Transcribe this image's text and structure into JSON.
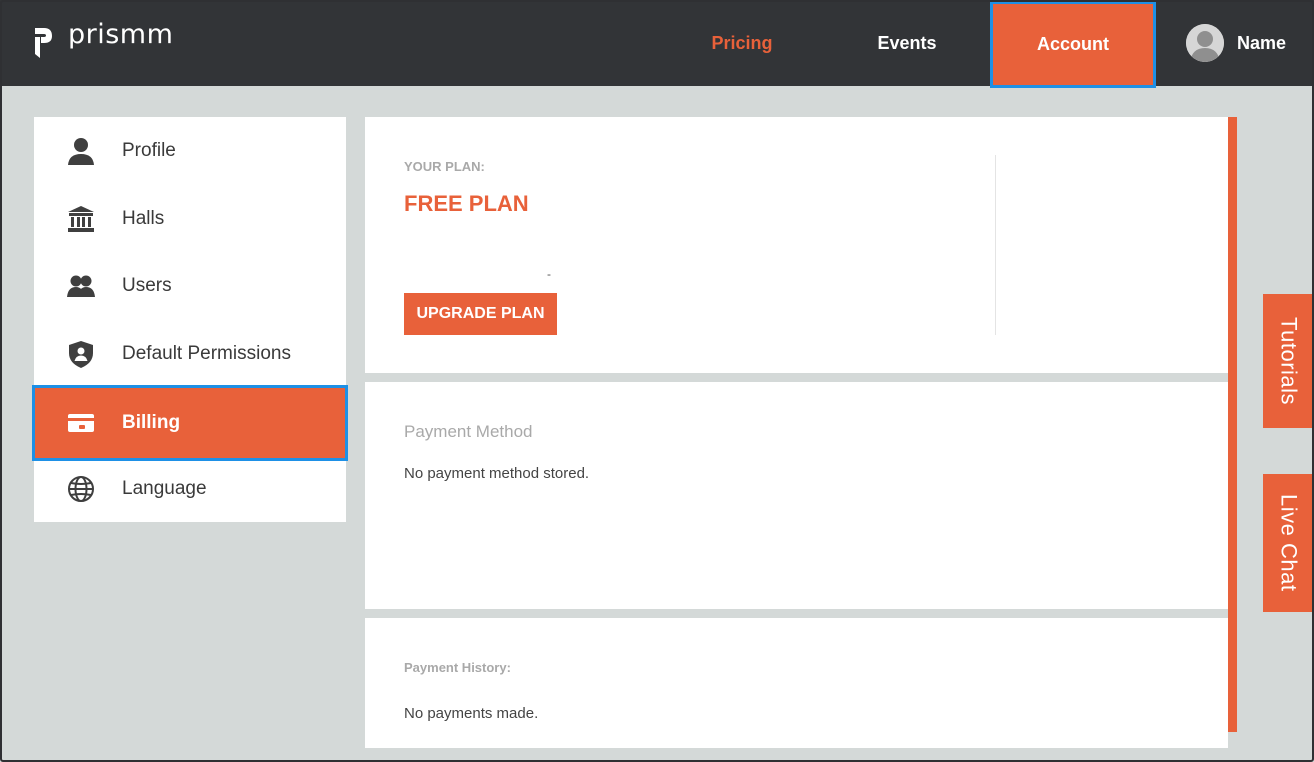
{
  "app": {
    "logo_text": "prismm"
  },
  "nav": {
    "pricing": "Pricing",
    "events": "Events",
    "account": "Account",
    "user_name": "Name"
  },
  "sidebar": {
    "items": [
      {
        "label": "Profile",
        "icon": "person-icon"
      },
      {
        "label": "Halls",
        "icon": "building-icon"
      },
      {
        "label": "Users",
        "icon": "users-icon"
      },
      {
        "label": "Default Permissions",
        "icon": "shield-icon"
      },
      {
        "label": "Billing",
        "icon": "credit-card-icon",
        "active": true
      },
      {
        "label": "Language",
        "icon": "globe-icon"
      }
    ]
  },
  "plan": {
    "label": "YOUR PLAN:",
    "name": "FREE PLAN",
    "dash": "-",
    "upgrade_button": "UPGRADE PLAN"
  },
  "payment": {
    "title": "Payment Method",
    "message": "No payment method stored."
  },
  "history": {
    "title": "Payment History:",
    "message": "No payments made."
  },
  "side_tabs": {
    "tutorials": "Tutorials",
    "live_chat": "Live Chat"
  },
  "colors": {
    "accent": "#e8613a",
    "topbar": "#323437",
    "background": "#d4d9d8",
    "highlight": "#1e90e6"
  }
}
